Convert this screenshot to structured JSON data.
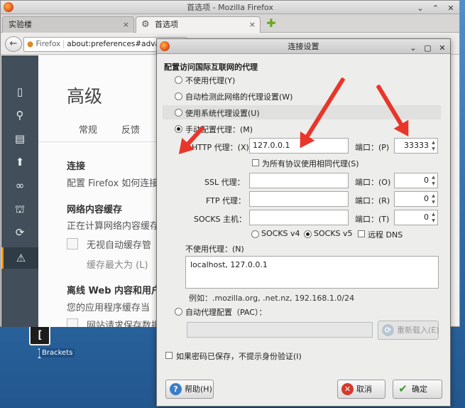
{
  "firefox": {
    "title": "首选项 - Mozilla Firefox",
    "tabs": [
      {
        "label": "实验楼",
        "close": "×"
      },
      {
        "label": "首选项",
        "close": "×"
      }
    ],
    "url_identity": "Firefox",
    "url": "about:preferences#advanced",
    "prefs": {
      "title": "高级",
      "tabs": [
        "常规",
        "反馈"
      ],
      "connection_heading": "连接",
      "connection_desc": "配置 Firefox 如何连接",
      "cache_heading": "网络内容缓存",
      "cache_desc": "正在计算网络内容缓存",
      "cache_override": "无视自动缓存管",
      "cache_limit": "缓存最大为 (L)",
      "offline_heading": "离线 Web 内容和用户数据",
      "offline_desc": "您的应用程序缓存当",
      "offline_warn": "网站请求保存数据"
    }
  },
  "desktop": {
    "bracket_label": "Brackets",
    "bracket_glyph": "[ ]"
  },
  "dialog": {
    "title": "连接设置",
    "group_label": "配置访问国际互联网的代理",
    "options": {
      "no_proxy": "不使用代理(Y)",
      "auto_detect": "自动检测此网络的代理设置(W)",
      "system": "使用系统代理设置(U)",
      "manual": "手动配置代理：(M)",
      "auto_config": "自动代理配置（PAC）："
    },
    "http_label": "HTTP 代理：(X)",
    "http_value": "127.0.0.1",
    "http_port_label": "端口：(P)",
    "http_port": "33333",
    "same_proxy": "为所有协议使用相同代理(S)",
    "ssl_label": "SSL 代理：",
    "ssl_value": "",
    "ssl_port_label": "端口：(O)",
    "ssl_port": "0",
    "ftp_label": "FTP 代理：",
    "ftp_value": "",
    "ftp_port_label": "端口：(R)",
    "ftp_port": "0",
    "socks_label": "SOCKS 主机：",
    "socks_value": "",
    "socks_port_label": "端口：(T)",
    "socks_port": "0",
    "socks_v4": "SOCKS v4",
    "socks_v5": "SOCKS v5",
    "remote_dns": "远程 DNS",
    "no_proxy_for": "不使用代理：(N)",
    "no_proxy_list": "localhost, 127.0.0.1",
    "example": "例如：.mozilla.org, .net.nz, 192.168.1.0/24",
    "pac_url": "",
    "reload_button": "重新载入(E)",
    "no_prompt_auth": "如果密码已保存，不提示身份验证(I)",
    "help_button": "帮助(H)",
    "cancel_button": "取消",
    "ok_button": "确定"
  },
  "annotation_color": "#e8362a"
}
